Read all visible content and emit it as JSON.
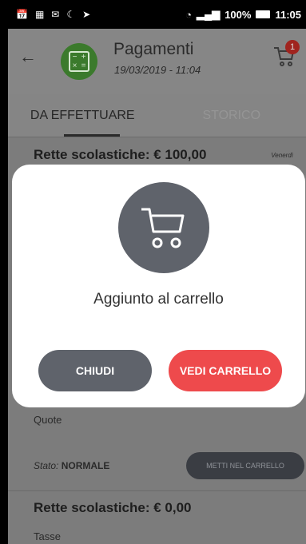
{
  "status_bar": {
    "left_icons": [
      "calendar-icon",
      "grid-icon",
      "mail-icon",
      "moon-icon",
      "cast-icon"
    ],
    "battery": "100%",
    "time": "11:05"
  },
  "header": {
    "title": "Pagamenti",
    "subtitle": "19/03/2019 - 11:04",
    "cart_badge": "1"
  },
  "tabs": [
    {
      "label": "DA EFFETTUARE",
      "active": true
    },
    {
      "label": "STORICO",
      "active": false
    }
  ],
  "list": {
    "item1_title": "Rette scolastiche: € 100,00",
    "item1_date": "Venerdì",
    "item1_category": "Quote",
    "item1_status_label": "Stato:",
    "item1_status_value": "NORMALE",
    "item1_button": "METTI NEL CARRELLO",
    "item2_title": "Rette scolastiche: € 0,00",
    "item2_category": "Tasse"
  },
  "modal": {
    "message": "Aggiunto al carrello",
    "close_label": "CHIUDI",
    "cart_label": "VEDI CARRELLO"
  },
  "colors": {
    "danger": "#ee4a4c",
    "neutral_button": "#5f636b",
    "app_icon_green": "#3b7a2c"
  }
}
